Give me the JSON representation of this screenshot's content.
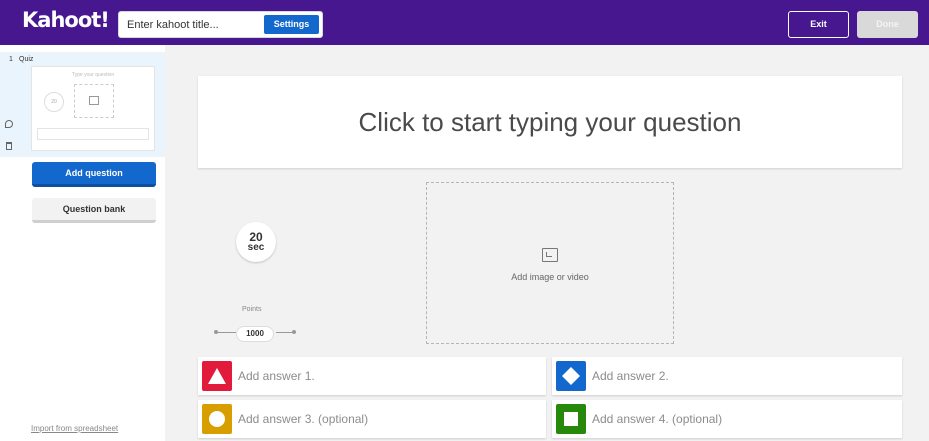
{
  "topbar": {
    "logo": "Kahoot!",
    "title_placeholder": "Enter kahoot title...",
    "settings_label": "Settings",
    "exit_label": "Exit",
    "done_label": "Done",
    "bg_color": "#46178f"
  },
  "sidebar": {
    "slides": [
      {
        "number": "1",
        "type": "Quiz",
        "thumb_question": "Type your question",
        "thumb_timer": "20"
      }
    ],
    "add_question_label": "Add question",
    "question_bank_label": "Question bank",
    "import_label": "Import from spreadsheet"
  },
  "editor": {
    "question_placeholder": "Click to start typing your question",
    "timer_value": "20",
    "timer_unit": "sec",
    "points_label": "Points",
    "points_value": "1000",
    "media_label": "Add image or video",
    "answers": [
      {
        "label": "Add answer 1.",
        "color": "#e21b3c",
        "shape": "triangle-icon"
      },
      {
        "label": "Add answer 2.",
        "color": "#1368ce",
        "shape": "diamond-icon"
      },
      {
        "label": "Add answer 3. (optional)",
        "color": "#d89e00",
        "shape": "circle-icon"
      },
      {
        "label": "Add answer 4. (optional)",
        "color": "#26890c",
        "shape": "square-icon"
      }
    ]
  }
}
